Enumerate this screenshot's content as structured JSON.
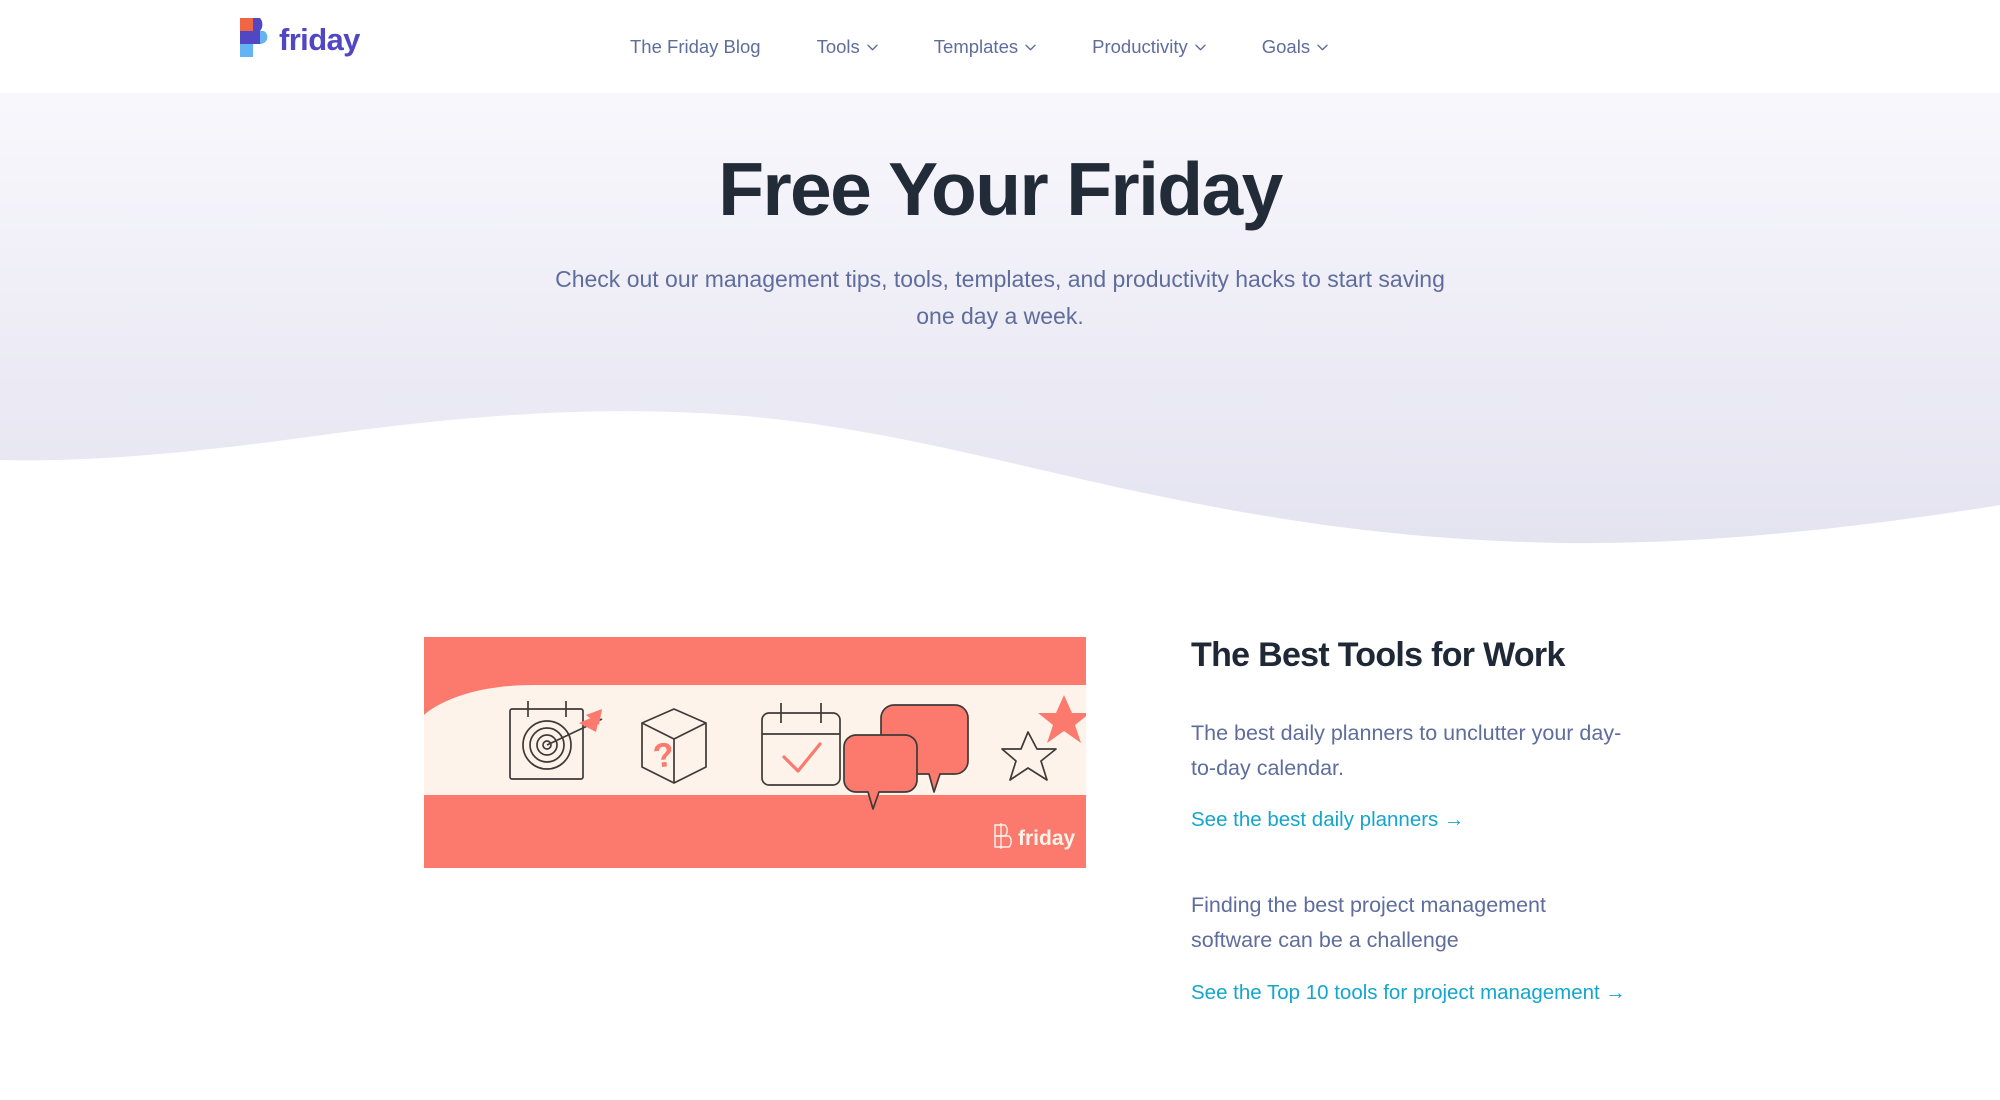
{
  "header": {
    "logo": {
      "icon": "friday-f-logo-icon",
      "word": "friday",
      "colors": {
        "orange": "#f06543",
        "purple": "#5146c4",
        "blue": "#63b3f5"
      }
    },
    "nav": [
      {
        "label": "The Friday Blog",
        "has_caret": false,
        "icon": ""
      },
      {
        "label": "Tools",
        "has_caret": true,
        "icon": "chevron-down-icon"
      },
      {
        "label": "Templates",
        "has_caret": true,
        "icon": "chevron-down-icon"
      },
      {
        "label": "Productivity",
        "has_caret": true,
        "icon": "chevron-down-icon"
      },
      {
        "label": "Goals",
        "has_caret": true,
        "icon": "chevron-down-icon"
      }
    ]
  },
  "hero": {
    "title": "Free Your Friday",
    "subtitle": "Check out our management tips, tools, templates, and productivity hacks to start saving one day a week.",
    "gradient_from": "#fbfbfd",
    "gradient_to": "#e4e3f0",
    "title_color": "#222b38",
    "subtitle_color": "#5e6d9c"
  },
  "feature": {
    "card": {
      "name": "best-tools-illustration",
      "background_color": "#fb7a6d",
      "band_color": "#fdf3ea",
      "outline_color": "#3f3a38",
      "accent_color": "#fb7a6d",
      "watermark": "friday",
      "icons": [
        "target-board-icon",
        "mystery-box-icon",
        "calendar-check-icon",
        "chat-bubbles-icon",
        "stars-icon"
      ]
    },
    "title": "The Best Tools for Work",
    "paragraph_1": "The best daily planners to unclutter your day-to-day calendar.",
    "link_1": "See the best daily planners →",
    "paragraph_2": "Finding the best project management software can be a challenge",
    "link_2": "See the Top 10 tools for project management →",
    "link_color": "#14a5cd",
    "title_color": "#1f2836",
    "body_color": "#5e6d9c"
  }
}
